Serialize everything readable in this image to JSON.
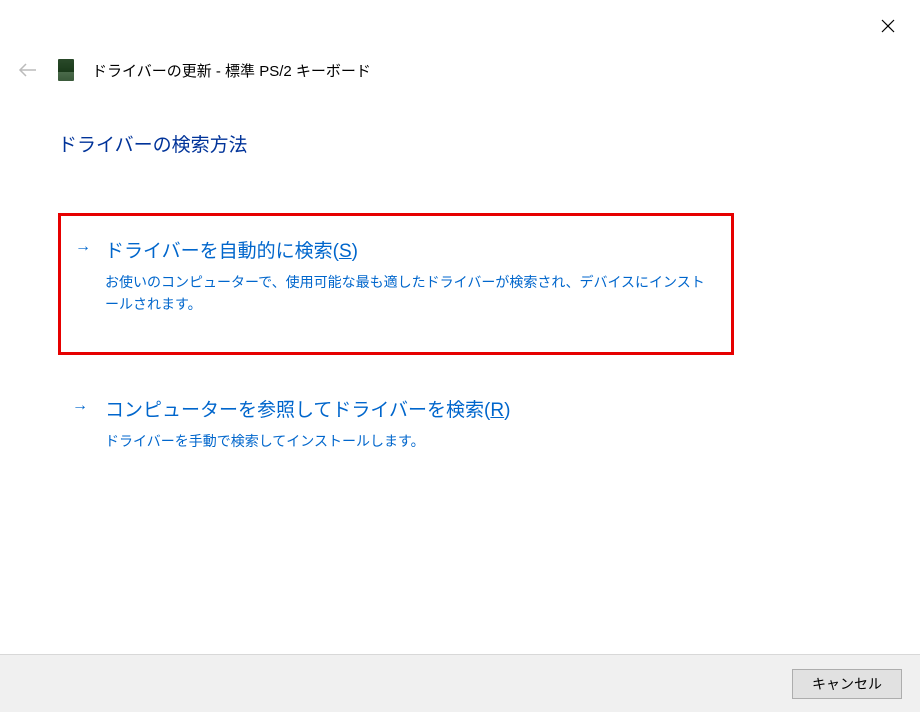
{
  "header": {
    "title": "ドライバーの更新 - 標準 PS/2 キーボード"
  },
  "section": {
    "title": "ドライバーの検索方法"
  },
  "options": [
    {
      "title_pre": "ドライバーを自動的に検索(",
      "accel": "S",
      "title_post": ")",
      "description": "お使いのコンピューターで、使用可能な最も適したドライバーが検索され、デバイスにインストールされます。"
    },
    {
      "title_pre": "コンピューターを参照してドライバーを検索(",
      "accel": "R",
      "title_post": ")",
      "description": "ドライバーを手動で検索してインストールします。"
    }
  ],
  "footer": {
    "cancel": "キャンセル"
  }
}
